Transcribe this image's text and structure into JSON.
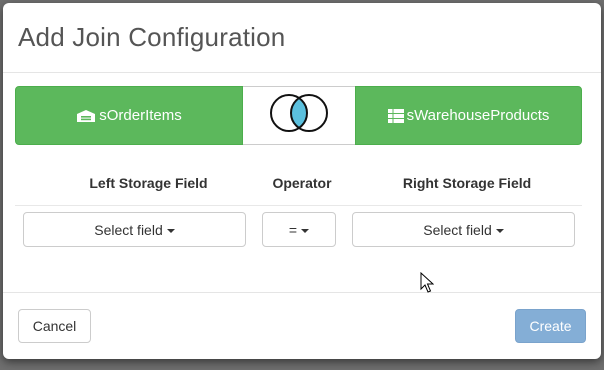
{
  "dialog": {
    "title": "Add Join Configuration"
  },
  "join_bar": {
    "left_storage": {
      "label": "sOrderItems",
      "icon": "storage-icon"
    },
    "join_type": {
      "icon": "venn-inner-join-icon",
      "highlight_color": "#5bc0de"
    },
    "right_storage": {
      "label": "sWarehouseProducts",
      "icon": "table-icon"
    },
    "accent_color": "#5cb85c"
  },
  "fields": {
    "left_header": "Left Storage Field",
    "operator_header": "Operator",
    "right_header": "Right Storage Field",
    "left_select": "Select field",
    "operator_select": "=",
    "right_select": "Select field"
  },
  "footer": {
    "cancel_label": "Cancel",
    "create_label": "Create",
    "create_color": "#84aed6"
  }
}
